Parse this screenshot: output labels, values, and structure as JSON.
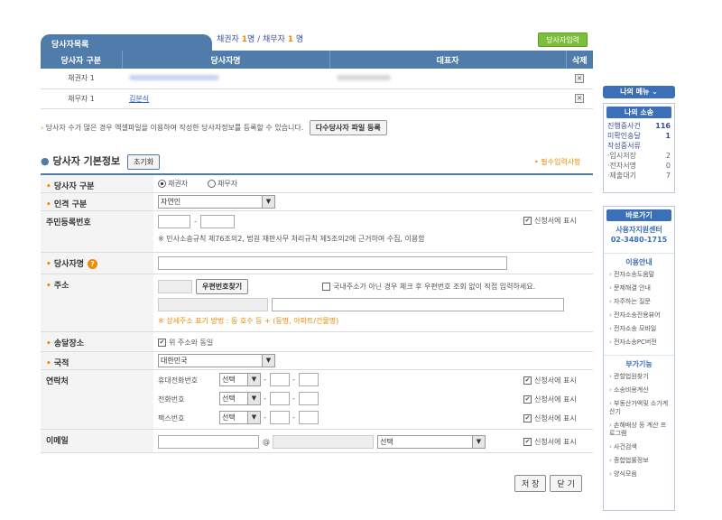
{
  "party_list": {
    "tab_label": "당사자목록",
    "counts": {
      "creditor_label": "채권자",
      "creditor_count": "1",
      "creditor_unit": "명 / ",
      "debtor_label": "채무자",
      "debtor_count": "1",
      "debtor_unit": "명"
    },
    "add_button": "당사자입력",
    "headers": [
      "당사자 구분",
      "당사자명",
      "대표자",
      "삭제"
    ],
    "rows": [
      {
        "role": "채권자 1",
        "name": "",
        "rep": ""
      },
      {
        "role": "채무자 1",
        "name": "김분식",
        "rep": ""
      }
    ],
    "notice": "당사자 수가 많은 경우 엑셀파일을 이용하여 작성한 당사자정보를 등록할 수 있습니다.",
    "bulk_button": "다수당사자 파일 등록"
  },
  "basic_info": {
    "title": "당사자 기본정보",
    "reset_button": "초기화",
    "required_note": "• 필수입력사항",
    "party_type_label": "당사자 구분",
    "party_type_options": [
      "채권자",
      "채무자"
    ],
    "personality_label": "인격 구분",
    "personality_value": "자연인",
    "rrn_label": "주민등록번호",
    "rrn_dash": "-",
    "rrn_note": "※ 민사소송규칙 제76조의2, 법원 재판사무 처리규칙 제5조의2에 근거하여 수집, 이용함",
    "show_in_petition": "신청서에 표시",
    "name_label": "당사자명",
    "address_label": "주소",
    "postcode_button": "우편번호찾기",
    "foreign_address_note": "국내주소가 아닌 경우 체크 후 우편번호 조회 없이 직접 입력하세요.",
    "address_example": "※ 상세주소 표기 방법 : 동 호수 등 + (동명, 아파트/건물명)",
    "delivery_label": "송달장소",
    "delivery_same": "위 주소와 동일",
    "nationality_label": "국적",
    "nationality_value": "대한민국",
    "contact_label": "연락처",
    "contacts": [
      {
        "label": "휴대전화번호",
        "select": "선택"
      },
      {
        "label": "전화번호",
        "select": "선택"
      },
      {
        "label": "팩스번호",
        "select": "선택"
      }
    ],
    "email_label": "이메일",
    "email_at": "@",
    "email_select": "선택",
    "save_button": "저 장",
    "close_button": "닫 기"
  },
  "sidebar": {
    "my_menu": "나의 메뉴 ⌄",
    "my_cases_title": "나의 소송",
    "my_cases": [
      {
        "label": "진행중사건",
        "count": "116"
      },
      {
        "label": "미확인송달",
        "count": "1"
      },
      {
        "label": "작성중서류",
        "count": ""
      }
    ],
    "drafts": [
      {
        "label": "·임시저장",
        "count": "2"
      },
      {
        "label": "·전자서명",
        "count": "0"
      },
      {
        "label": "·제출대기",
        "count": "7"
      }
    ],
    "quick_title": "바로가기",
    "center_name": "사용자지원센터",
    "center_phone": "02-3480-1715",
    "guide_title": "이용안내",
    "guide_items": [
      "전자소송도움말",
      "문제해결 안내",
      "자주하는 질문",
      "전자소송전용뷰어",
      "전자소송 모바일",
      "전자소송PC버전"
    ],
    "extra_title": "부가기능",
    "extra_items": [
      "관할법원찾기",
      "소송비용계산",
      "부동산가액및 소가계산기",
      "손해배상 등 계산 프로그램",
      "사건검색",
      "종합법률정보",
      "양식모음"
    ]
  },
  "colors": {
    "accent": "#4f7cab",
    "orange": "#f08a00",
    "green": "#7bbf3a"
  }
}
